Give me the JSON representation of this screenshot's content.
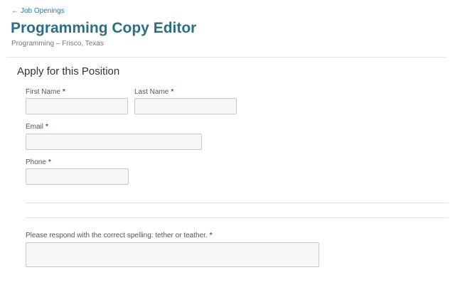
{
  "header": {
    "back_arrow": "←",
    "back_label": "Job Openings",
    "job_title": "Programming Copy Editor",
    "job_meta": "Programming – Frisco, Texas"
  },
  "form": {
    "section_title": "Apply for this Position",
    "required_mark": "*",
    "fields": {
      "first_name": {
        "label": "First Name",
        "value": "",
        "placeholder": ""
      },
      "last_name": {
        "label": "Last Name",
        "value": "",
        "placeholder": ""
      },
      "email": {
        "label": "Email",
        "value": "",
        "placeholder": ""
      },
      "phone": {
        "label": "Phone",
        "value": "",
        "placeholder": ""
      },
      "spelling_question": {
        "label": "Please respond with the correct spelling: tether or teather.",
        "value": "",
        "placeholder": ""
      }
    }
  },
  "colors": {
    "title": "#2b6f86",
    "link": "#2a7ab0",
    "required": "#2a6fa0"
  }
}
